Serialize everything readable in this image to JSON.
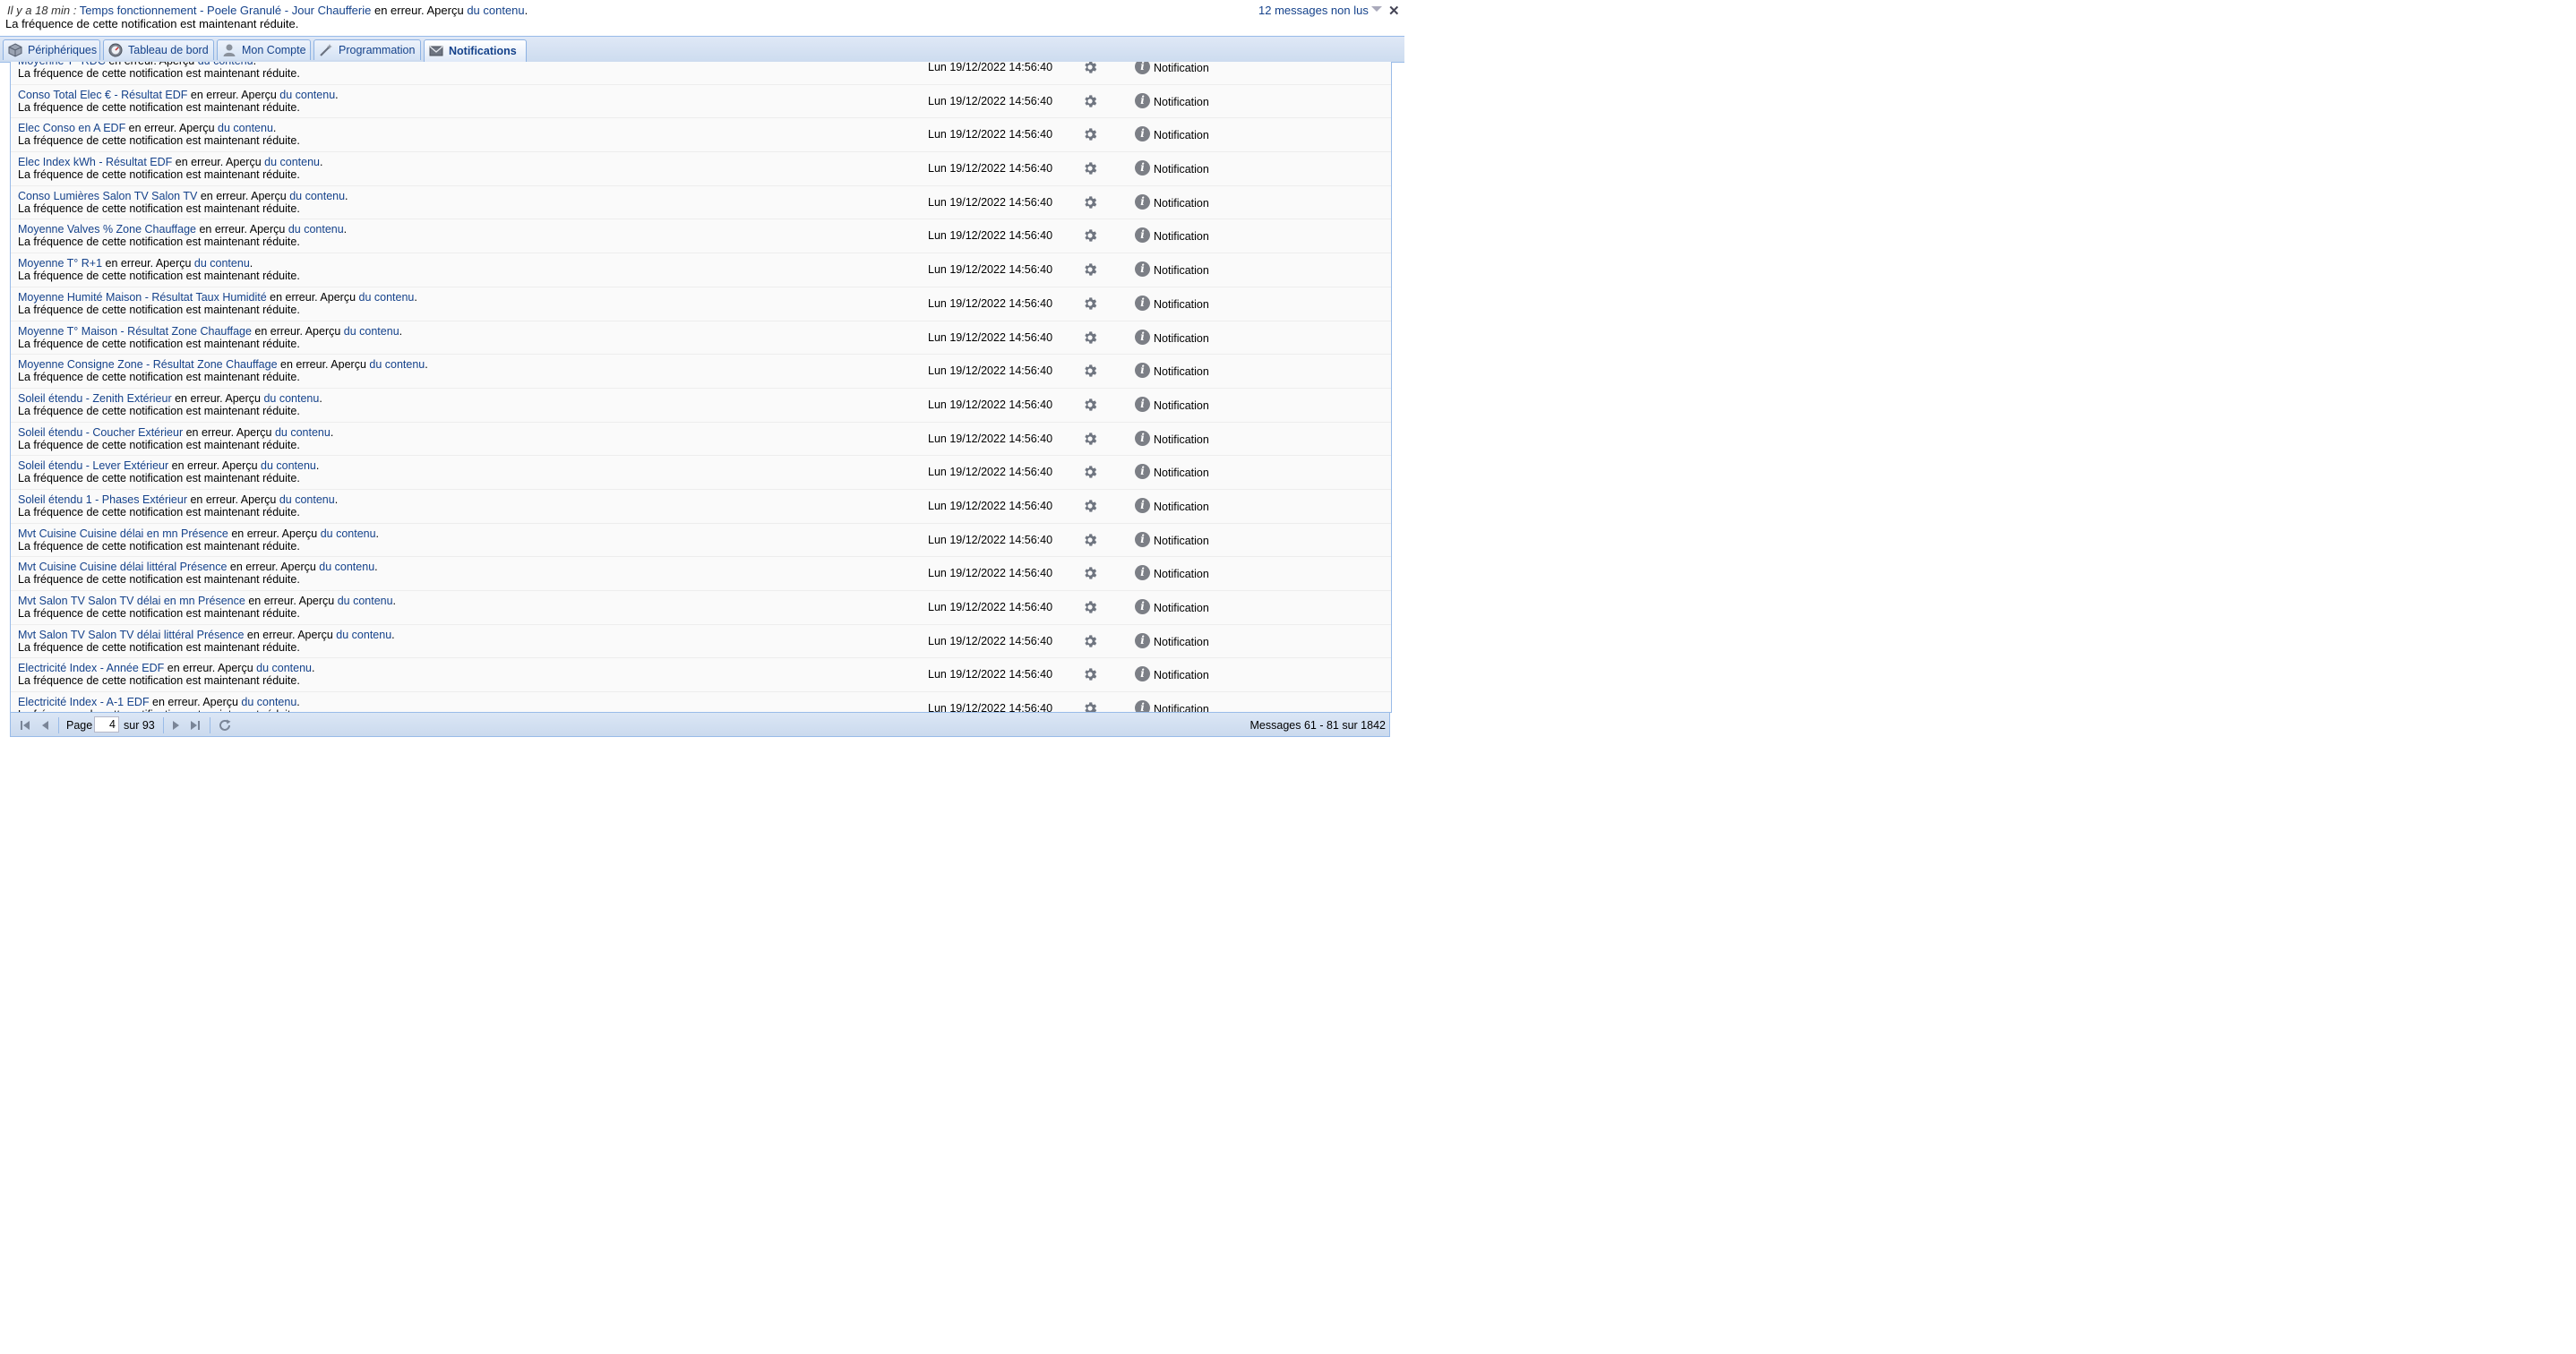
{
  "banner": {
    "ago": "Il y a 18 min :",
    "device": "Temps fonctionnement - Poele Granulé - Jour Chaufferie",
    "status": " en erreur. Aperçu ",
    "link": "du contenu",
    "period": ".",
    "line2": "La fréquence de cette notification est maintenant réduite.",
    "unread": "12 messages non lus",
    "close": "✕"
  },
  "tabs": [
    {
      "label": "Périphériques",
      "icon": "cube-icon"
    },
    {
      "label": "Tableau de bord",
      "icon": "dashboard-icon"
    },
    {
      "label": "Mon Compte",
      "icon": "user-icon"
    },
    {
      "label": "Programmation",
      "icon": "wand-icon"
    },
    {
      "label": "Notifications",
      "icon": "envelope-icon",
      "active": true
    }
  ],
  "common": {
    "status": " en erreur. Aperçu ",
    "link": "du contenu",
    "period": ".",
    "line2": "La fréquence de cette notification est maintenant réduite.",
    "date": "Lun 19/12/2022 14:56:40",
    "type": "Notification"
  },
  "rows": [
    "Moyenne T° RDC",
    "Conso Total Elec € - Résultat EDF",
    "Elec Conso en A EDF",
    "Elec Index kWh - Résultat EDF",
    "Conso Lumières Salon TV Salon TV",
    "Moyenne Valves % Zone Chauffage",
    "Moyenne T° R+1",
    "Moyenne Humité Maison - Résultat Taux Humidité",
    "Moyenne T° Maison - Résultat Zone Chauffage",
    "Moyenne Consigne Zone - Résultat Zone Chauffage",
    "Soleil étendu - Zenith Extérieur",
    "Soleil étendu - Coucher Extérieur",
    "Soleil étendu - Lever Extérieur",
    "Soleil étendu 1 - Phases Extérieur",
    "Mvt Cuisine Cuisine délai en mn Présence",
    "Mvt Cuisine Cuisine délai littéral Présence",
    "Mvt Salon TV Salon TV délai en mn Présence",
    "Mvt Salon TV Salon TV délai littéral Présence",
    "Electricité Index - Année EDF",
    "Electricité Index - A-1 EDF"
  ],
  "pager": {
    "page_label": "Page",
    "page_value": "4",
    "of_label": "sur 93",
    "summary": "Messages 61 - 81 sur 1842"
  }
}
